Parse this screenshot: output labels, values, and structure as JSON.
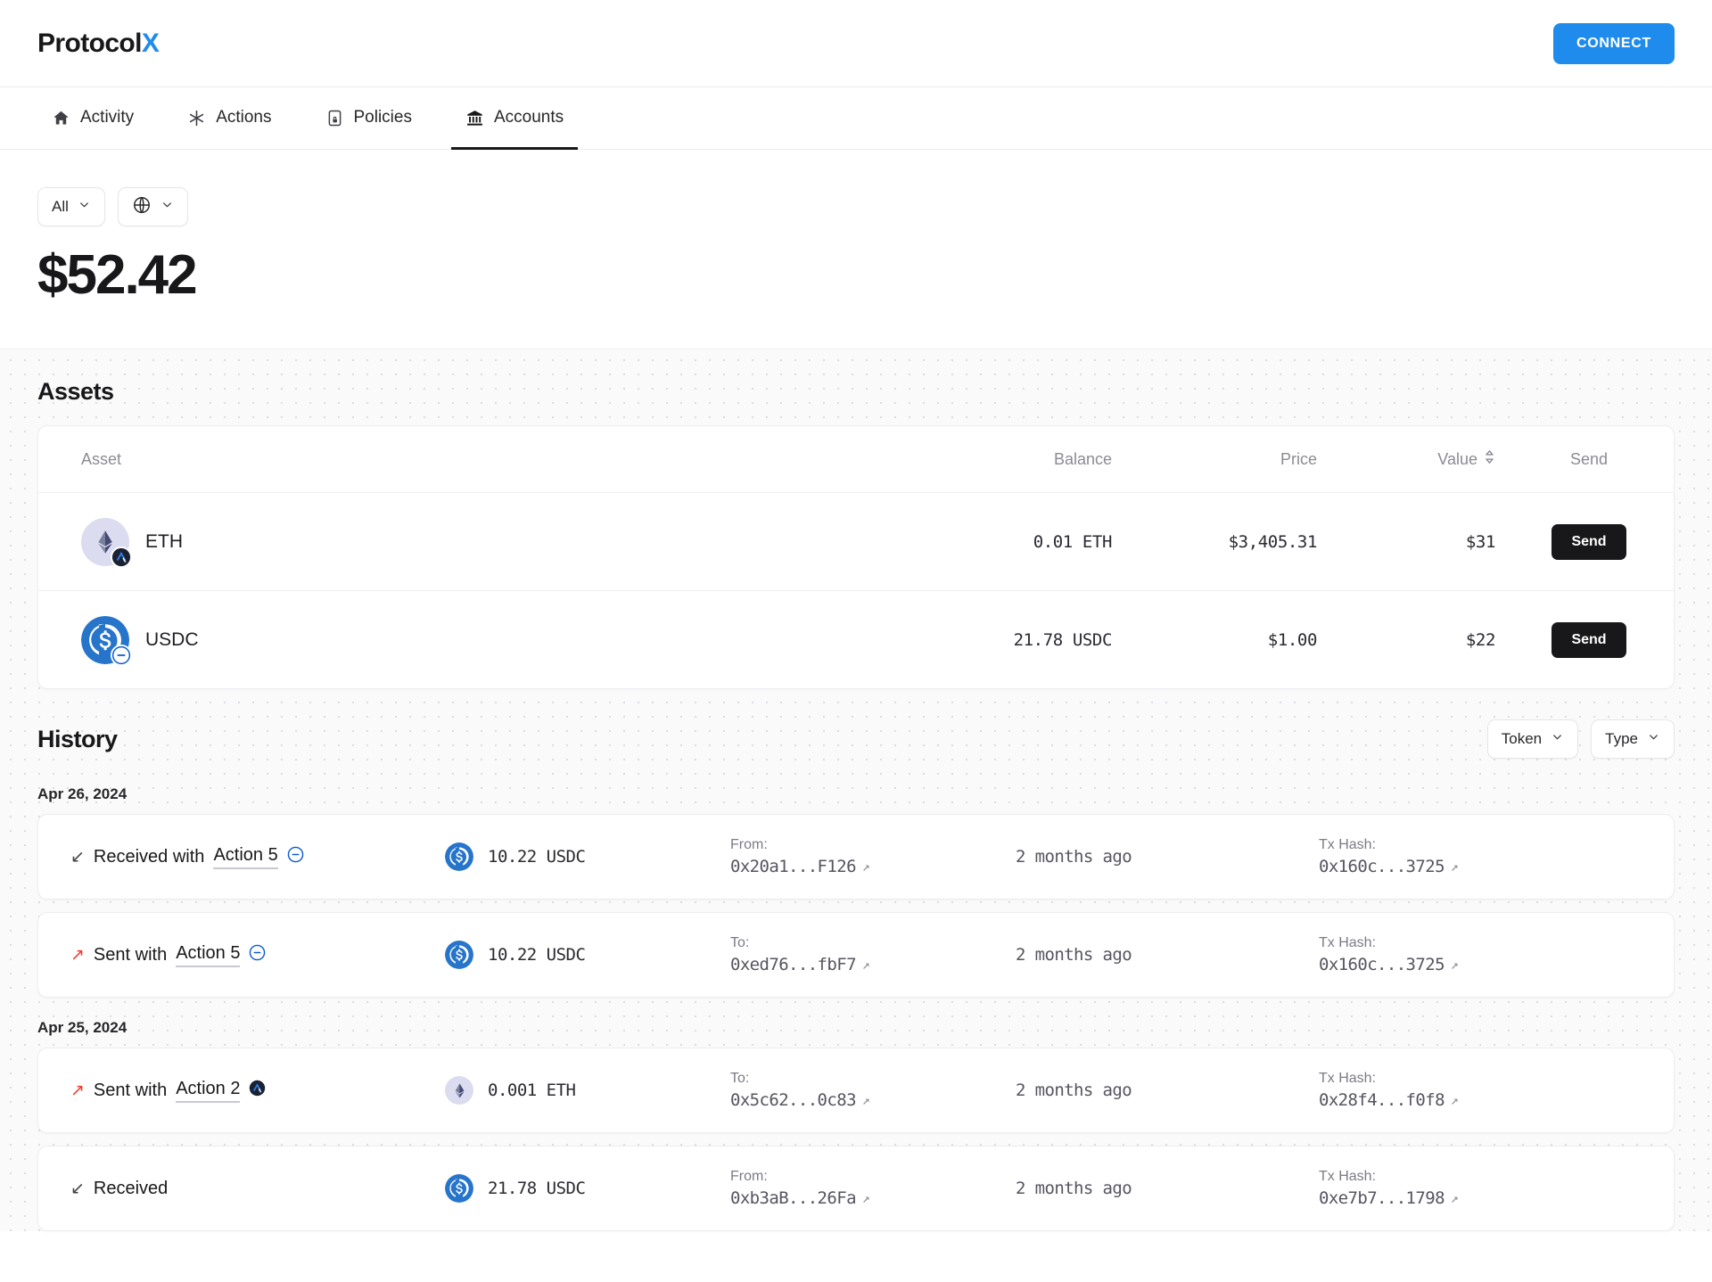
{
  "brand": {
    "name_main": "Protocol",
    "name_accent": "X",
    "accent_color": "#1f8ced"
  },
  "header": {
    "connect_label": "CONNECT"
  },
  "nav": {
    "tabs": [
      {
        "label": "Activity",
        "icon": "home-icon",
        "active": false
      },
      {
        "label": "Actions",
        "icon": "asterisk-icon",
        "active": false
      },
      {
        "label": "Policies",
        "icon": "policy-document-icon",
        "active": false
      },
      {
        "label": "Accounts",
        "icon": "bank-icon",
        "active": true
      }
    ]
  },
  "balance": {
    "filters": [
      {
        "label": "All",
        "icon": "chevron-down-icon"
      },
      {
        "label": "",
        "icon": "globe-icon"
      }
    ],
    "total": "$52.42"
  },
  "assets": {
    "title": "Assets",
    "columns": {
      "asset": "Asset",
      "balance": "Balance",
      "price": "Price",
      "value": "Value",
      "send": "Send"
    },
    "rows": [
      {
        "symbol": "ETH",
        "icon": "ethereum-icon",
        "chain_badge": "arbitrum-icon",
        "balance": "0.01 ETH",
        "price": "$3,405.31",
        "value": "$31",
        "send_label": "Send"
      },
      {
        "symbol": "USDC",
        "icon": "usdc-icon",
        "chain_badge": "base-icon",
        "balance": "21.78 USDC",
        "price": "$1.00",
        "value": "$22",
        "send_label": "Send"
      }
    ]
  },
  "history": {
    "title": "History",
    "filters": [
      {
        "label": "Token",
        "icon": "chevron-down-icon"
      },
      {
        "label": "Type",
        "icon": "chevron-down-icon"
      }
    ],
    "groups": [
      {
        "date": "Apr 26, 2024",
        "rows": [
          {
            "direction": "Received",
            "direction_prefix": "Received with",
            "arrow": "arrow-down-left-icon",
            "action_label": "Action 5",
            "action_badge": "base-icon",
            "token_icon": "usdc-icon",
            "amount": "10.22 USDC",
            "party_label": "From:",
            "party_address": "0x20a1...F126",
            "time_ago": "2 months ago",
            "hash_label": "Tx Hash:",
            "hash": "0x160c...3725"
          },
          {
            "direction": "Sent",
            "direction_prefix": "Sent with",
            "arrow": "arrow-up-right-icon",
            "action_label": "Action 5",
            "action_badge": "base-icon",
            "token_icon": "usdc-icon",
            "amount": "10.22 USDC",
            "party_label": "To:",
            "party_address": "0xed76...fbF7",
            "time_ago": "2 months ago",
            "hash_label": "Tx Hash:",
            "hash": "0x160c...3725"
          }
        ]
      },
      {
        "date": "Apr 25, 2024",
        "rows": [
          {
            "direction": "Sent",
            "direction_prefix": "Sent with",
            "arrow": "arrow-up-right-icon",
            "action_label": "Action 2",
            "action_badge": "arbitrum-icon",
            "token_icon": "ethereum-icon",
            "amount": "0.001 ETH",
            "party_label": "To:",
            "party_address": "0x5c62...0c83",
            "time_ago": "2 months ago",
            "hash_label": "Tx Hash:",
            "hash": "0x28f4...f0f8"
          },
          {
            "direction": "Received",
            "direction_prefix": "Received",
            "arrow": "arrow-down-left-icon",
            "action_label": "",
            "action_badge": "",
            "token_icon": "usdc-icon",
            "amount": "21.78 USDC",
            "party_label": "From:",
            "party_address": "0xb3aB...26Fa",
            "time_ago": "2 months ago",
            "hash_label": "Tx Hash:",
            "hash": "0xe7b7...1798"
          }
        ]
      }
    ]
  }
}
